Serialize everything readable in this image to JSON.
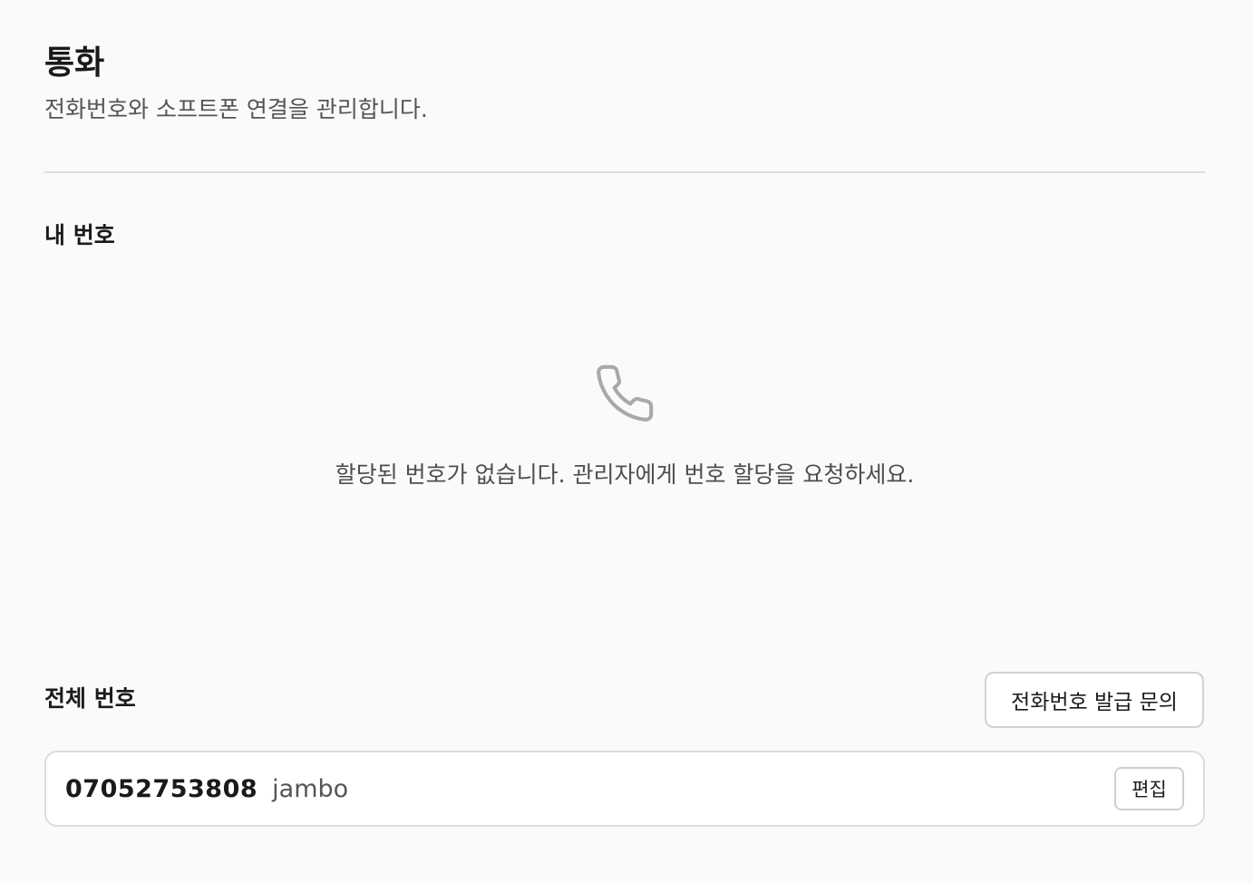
{
  "header": {
    "title": "통화",
    "subtitle": "전화번호와 소프트폰 연결을 관리합니다."
  },
  "my_numbers": {
    "title": "내 번호",
    "empty_icon": "phone-icon",
    "empty_message": "할당된 번호가 없습니다. 관리자에게 번호 할당을 요청하세요."
  },
  "all_numbers": {
    "title": "전체 번호",
    "inquiry_button_label": "전화번호 발급 문의",
    "items": [
      {
        "number": "07052753808",
        "alias": "jambo",
        "edit_label": "편집"
      }
    ]
  },
  "colors": {
    "background": "#fafafa",
    "border": "#dcdcdc",
    "icon": "#a9a9a9"
  }
}
